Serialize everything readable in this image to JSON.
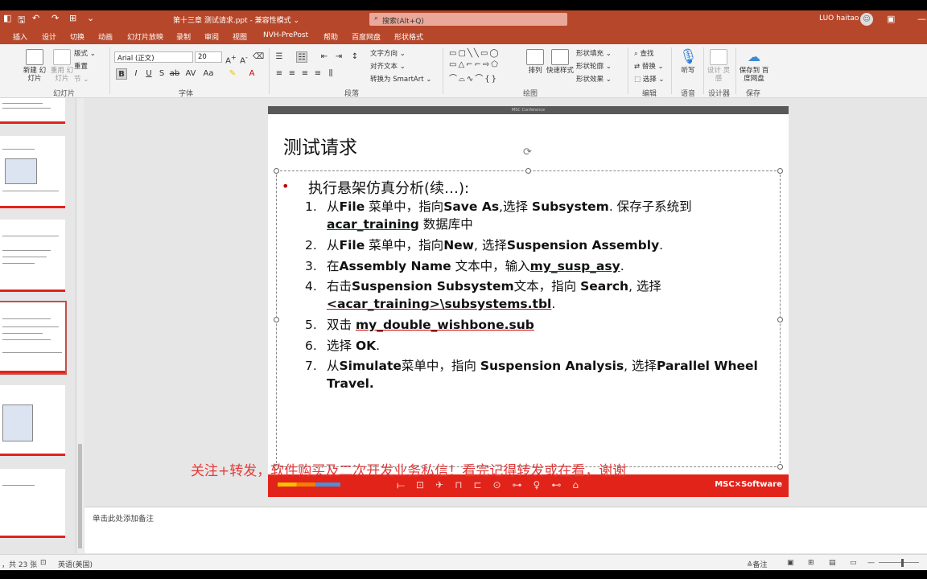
{
  "titlebar": {
    "doc_title": "第十三章 测试请求.ppt  -  兼容性模式  ⌄",
    "search_placeholder": "搜索(Alt+Q)",
    "user": "LUO haitao",
    "avatar": "☺"
  },
  "tabs": [
    "插入",
    "设计",
    "切换",
    "动画",
    "幻灯片放映",
    "录制",
    "审阅",
    "视图",
    "NVH-PrePost",
    "帮助",
    "百度网盘",
    "形状格式"
  ],
  "ribbon": {
    "new_slide": "新建\n幻灯片",
    "reuse_slide": "重用\n幻灯片",
    "layout": "版式 ⌄",
    "reset": "重置",
    "section": "节 ⌄",
    "slides_group": "幻灯片",
    "font_name": "Arial (正文)",
    "font_size": "20",
    "font_group": "字体",
    "text_direction": "文字方向 ⌄",
    "align_text": "对齐文本 ⌄",
    "smartart": "转换为 SmartArt ⌄",
    "paragraph_group": "段落",
    "arrange": "排列",
    "quick_styles": "快速样式",
    "shape_fill": "形状填充 ⌄",
    "shape_outline": "形状轮廓 ⌄",
    "shape_effects": "形状效果 ⌄",
    "drawing_group": "绘图",
    "find": "查找",
    "replace": "替换 ⌄",
    "select": "选择 ⌄",
    "editing_group": "编辑",
    "dictate": "听写",
    "voice_group": "语音",
    "designer_btn": "设计\n灵感",
    "designer_group": "设计器",
    "save_baidu": "保存到\n百度网盘",
    "save_group": "保存"
  },
  "slide": {
    "topbar": "MSC Conference",
    "title": "测试请求",
    "bullet": "执行悬架仿真分析(续…):",
    "items": [
      {
        "num": "1.",
        "html": "从<b>File</b> 菜单中，指向<b>Save As</b>,选择 <b>Subsystem</b>. 保存子系统到"
      },
      {
        "num": "",
        "html": "<b class='ul'>acar_training</b> 数据库中"
      },
      {
        "num": "2.",
        "html": "从<b>File</b> 菜单中，指向<b>New</b>, 选择<b>Suspension Assembly</b>."
      },
      {
        "num": "3.",
        "html": "在<b>Assembly Name</b> 文本中，输入<b class='ul'>my_susp_asy</b>."
      },
      {
        "num": "4.",
        "html": "右击<b>Suspension Subsystem</b>文本，指向 <b>Search</b>, 选择"
      },
      {
        "num": "",
        "html": "<b class='ul'>&lt;acar_training&gt;\\subsystems.tbl</b>."
      },
      {
        "num": "5.",
        "html": "双击 <b class='ul'>my_double_wishbone.sub</b>"
      },
      {
        "num": "6.",
        "html": " 选择 <b>OK</b>."
      },
      {
        "num": "7.",
        "html": "从<b>Simulate</b>菜单中，指向 <b>Suspension Analysis</b>, 选择<b>Parallel Wheel</b>"
      },
      {
        "num": "",
        "html": "<b>Travel.</b>"
      }
    ],
    "footer_logo": "MSC⨯Software"
  },
  "overlay": "关注+转发，软件购买及二次开发业务私信！看完记得转发或在看，谢谢",
  "notes_placeholder": "单击此处添加备注",
  "status": {
    "slide_count": "，共 23 张",
    "language": "英语(美国)",
    "notes": "≙备注"
  }
}
